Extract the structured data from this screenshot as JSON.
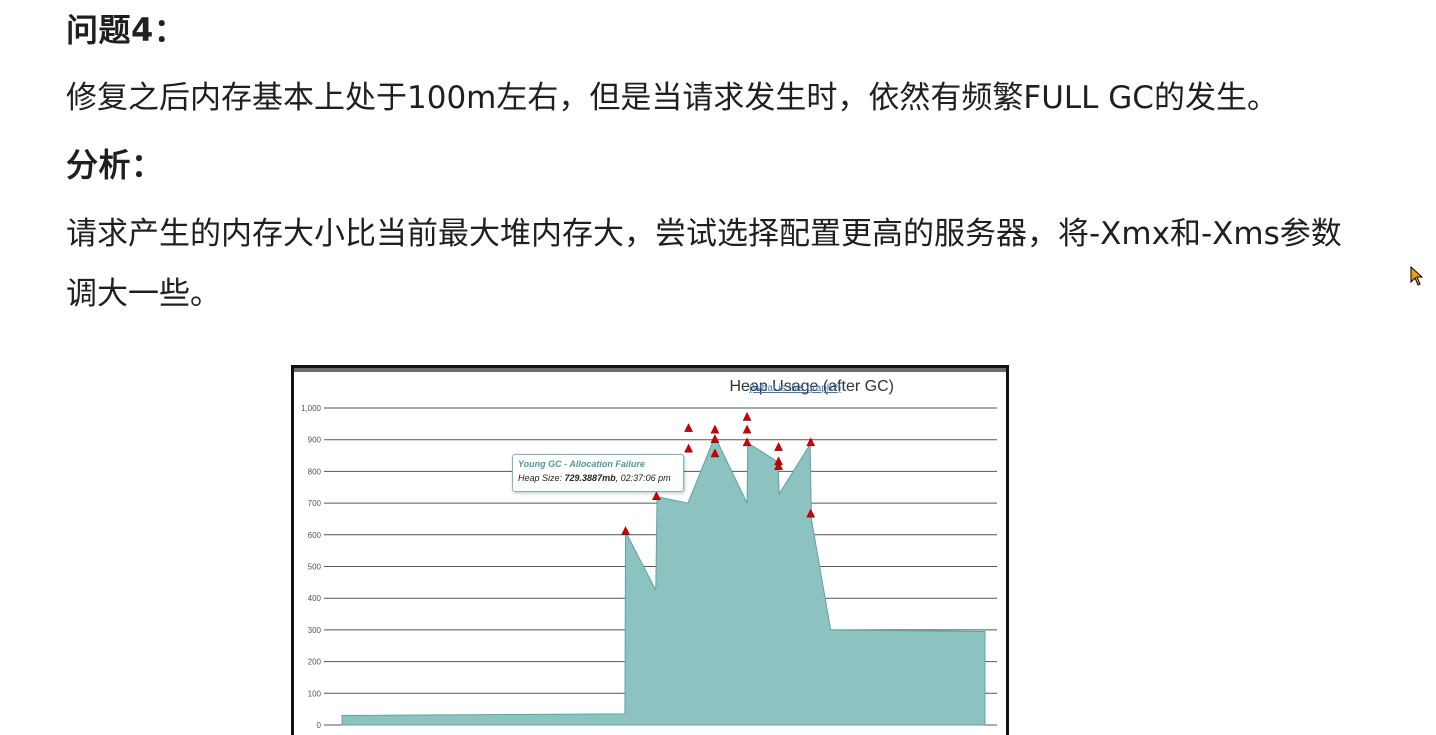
{
  "doc": {
    "heading1": "问题4：",
    "para1": "修复之后内存基本上处于100m左右，但是当请求发生时，依然有频繁FULL GC的发生。",
    "heading2": "分析：",
    "para2_line1": "请求产生的内存大小比当前最大堆内存大，尝试选择配置更高的服务器，将-Xmx和-Xms参数",
    "para2_line2": "调大一些。"
  },
  "chart": {
    "title": "Heap Usage (after GC)",
    "help_link": "(What is this graph?)",
    "tooltip": {
      "title": "Young GC - Allocation Failure",
      "label": "Heap Size: ",
      "value": "729.3887mb",
      "time": ", 02:37:06 pm"
    }
  },
  "colors": {
    "area_fill": "#8cc3c1",
    "area_stroke": "#5fa3a1",
    "marker": "#d40000",
    "link": "#3a78c2"
  },
  "chart_data": {
    "type": "area",
    "title": "Heap Usage (after GC)",
    "xlabel": "",
    "ylabel": "",
    "ylim": [
      0,
      1000
    ],
    "y_ticks": [
      "1,000",
      "900",
      "800",
      "700",
      "600",
      "500",
      "400",
      "300",
      "200",
      "100",
      "0"
    ],
    "grid": true,
    "xlim": [
      0,
      100
    ],
    "series": [
      {
        "values": [
          [
            0,
            30
          ],
          [
            44,
            35
          ],
          [
            44.1,
            610
          ],
          [
            48.8,
            425
          ],
          [
            49,
            720
          ],
          [
            53.8,
            700
          ],
          [
            58,
            910
          ],
          [
            63,
            700
          ],
          [
            63.1,
            890
          ],
          [
            67.8,
            830
          ],
          [
            68,
            730
          ],
          [
            72.8,
            885
          ],
          [
            73,
            650
          ],
          [
            76,
            300
          ],
          [
            100,
            295
          ]
        ]
      }
    ],
    "gc_markers": [
      [
        44.1,
        610
      ],
      [
        48.9,
        720
      ],
      [
        53.9,
        870
      ],
      [
        53.9,
        935
      ],
      [
        58,
        930
      ],
      [
        58,
        900
      ],
      [
        58,
        855
      ],
      [
        63,
        970
      ],
      [
        63,
        930
      ],
      [
        63,
        890
      ],
      [
        67.9,
        875
      ],
      [
        67.9,
        830
      ],
      [
        67.9,
        815
      ],
      [
        72.9,
        890
      ],
      [
        72.9,
        665
      ]
    ]
  }
}
